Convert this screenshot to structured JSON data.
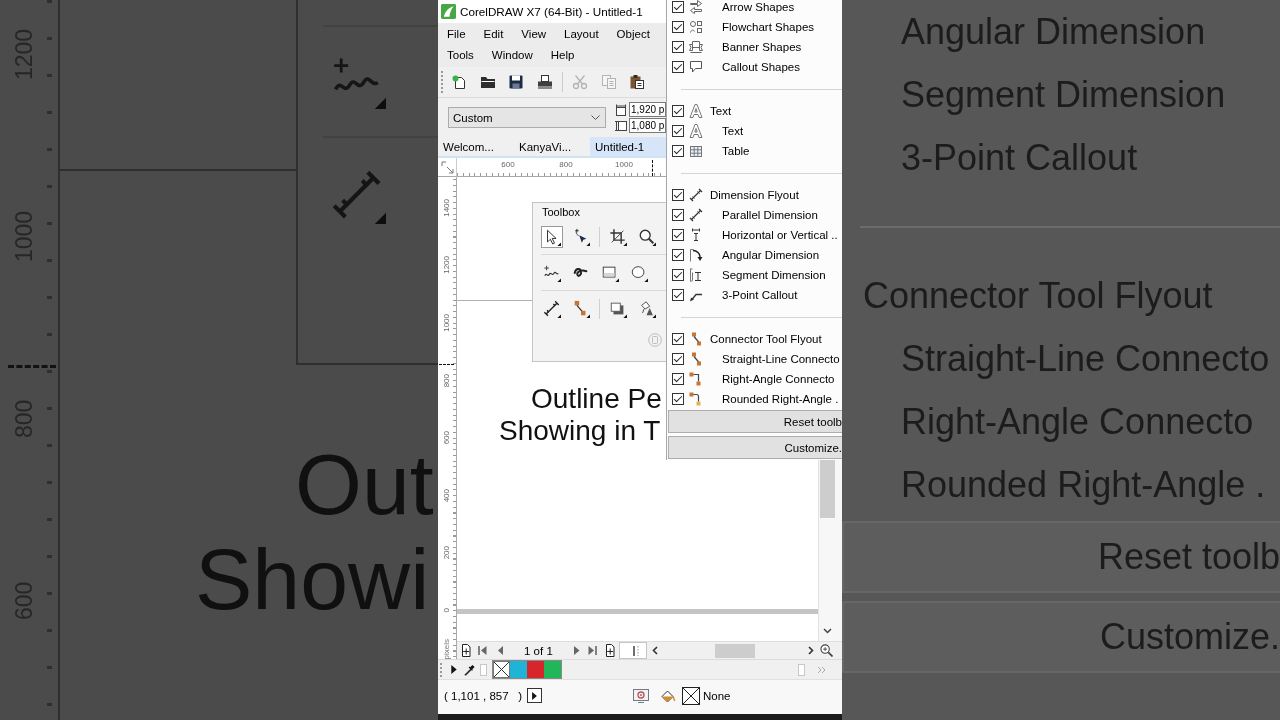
{
  "backdrop_left": {
    "ruler_labels": [
      "1200",
      "1000",
      "800",
      "600"
    ],
    "text_lines": [
      "Out",
      "Showi"
    ]
  },
  "window": {
    "title": "CorelDRAW X7 (64-Bit) - Untitled-1"
  },
  "menu_bar": [
    {
      "items": [
        "File",
        "Edit",
        "View",
        "Layout",
        "Object"
      ]
    },
    {
      "items": [
        "Tools",
        "Window",
        "Help"
      ]
    }
  ],
  "toolbar": [
    {
      "disabled": false
    },
    {
      "disabled": false
    },
    {
      "disabled": false
    },
    {
      "disabled": false
    },
    {
      "disabled": true
    },
    {
      "disabled": true
    },
    {
      "disabled": false
    }
  ],
  "property_bar": {
    "page_preset": "Custom",
    "page_width": "1,920 p",
    "page_height": "1,080 p"
  },
  "document_tabs": [
    {
      "label": "Welcom...",
      "selected": false
    },
    {
      "label": "KanyaVi...",
      "selected": false
    },
    {
      "label": "Untitled-1",
      "selected": true
    }
  ],
  "rulers": {
    "horizontal": [
      "600",
      "800",
      "1000"
    ],
    "vertical": [
      "1400",
      "1200",
      "1000",
      "800",
      "600",
      "400",
      "200",
      "0"
    ],
    "unit": "pixels"
  },
  "toolbox": {
    "title": "Toolbox",
    "rows": [
      {
        "tools": [
          {
            "selected": true
          },
          {
            "selected": false
          },
          {
            "selected": false
          },
          {
            "selected": false
          }
        ]
      },
      {
        "tools": [
          {
            "selected": false
          },
          {
            "selected": false
          },
          {
            "selected": false
          },
          {
            "selected": false
          }
        ]
      },
      {
        "tools": [
          {
            "selected": false
          },
          {
            "selected": false
          },
          {
            "selected": false
          },
          {
            "selected": false
          }
        ]
      }
    ]
  },
  "canvas_text": [
    "Outline Pe",
    "Showing in T"
  ],
  "toolbar_menu": {
    "groups": [
      {
        "children": [
          {
            "label": "Arrow Shapes",
            "checked": true
          },
          {
            "label": "Flowchart Shapes",
            "checked": true
          },
          {
            "label": "Banner Shapes",
            "checked": true
          },
          {
            "label": "Callout Shapes",
            "checked": true
          }
        ]
      },
      {
        "label": "Text",
        "checked": true,
        "children": [
          {
            "label": "Text",
            "checked": true
          },
          {
            "label": "Table",
            "checked": true
          }
        ]
      },
      {
        "label": "Dimension Flyout",
        "checked": true,
        "children": [
          {
            "label": "Parallel Dimension",
            "checked": true
          },
          {
            "label": "Horizontal or Vertical ..",
            "checked": true
          },
          {
            "label": "Angular Dimension",
            "checked": true
          },
          {
            "label": "Segment Dimension",
            "checked": true
          },
          {
            "label": "3-Point Callout",
            "checked": true
          }
        ]
      },
      {
        "label": "Connector Tool Flyout",
        "checked": true,
        "children": [
          {
            "label": "Straight-Line Connecto",
            "checked": true
          },
          {
            "label": "Right-Angle Connecto",
            "checked": true
          },
          {
            "label": "Rounded Right-Angle .",
            "checked": true
          }
        ]
      }
    ],
    "buttons": [
      "Reset toolb",
      "Customize."
    ]
  },
  "page_navigator": {
    "page": "1 of 1"
  },
  "palette": [
    {
      "kind": "none"
    },
    {
      "kind": "color",
      "color": "#1fb3d5"
    },
    {
      "kind": "color",
      "color": "#d7262b"
    },
    {
      "kind": "color",
      "color": "#1fb75a"
    }
  ],
  "status_bar": {
    "coordinates": "( 1,101 , 857   )",
    "fill": "None"
  },
  "backdrop_right": {
    "groups": [
      {
        "children": [
          "Angular Dimension",
          "Segment Dimension",
          "3-Point Callout"
        ]
      },
      {
        "label": "Connector Tool Flyout",
        "children": [
          "Straight-Line Connecto",
          "Right-Angle Connecto",
          "Rounded Right-Angle ."
        ]
      }
    ],
    "buttons": [
      "Reset toolb",
      "Customize."
    ]
  }
}
